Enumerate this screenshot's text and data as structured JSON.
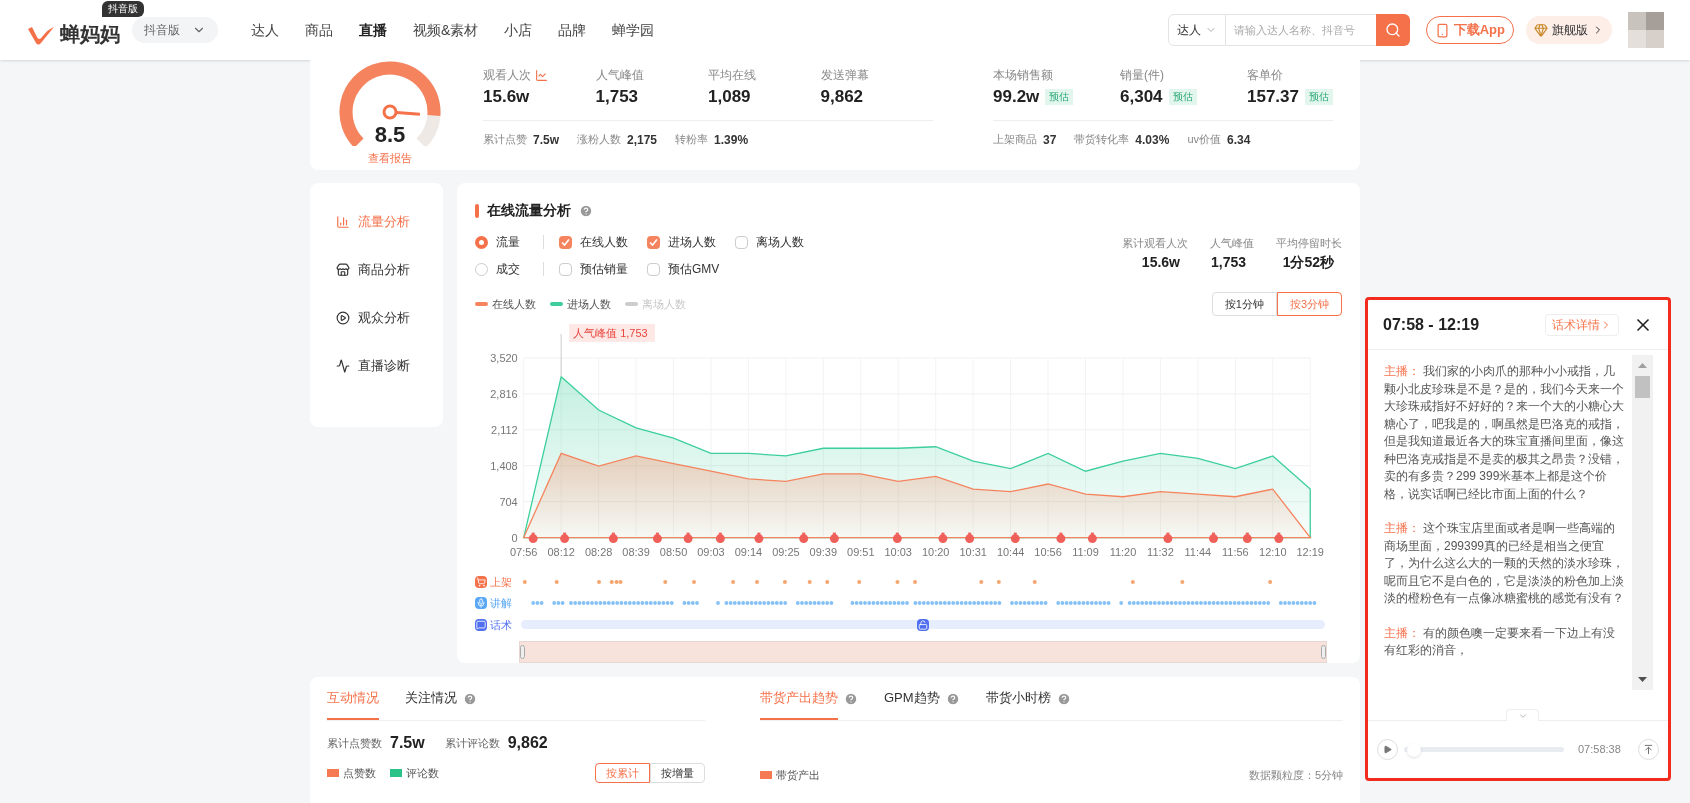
{
  "header": {
    "brand": "蝉妈妈",
    "brand_badge": "抖音版",
    "platform": "抖音版",
    "nav": [
      {
        "label": "达人",
        "selected": false
      },
      {
        "label": "商品",
        "selected": false
      },
      {
        "label": "直播",
        "selected": true
      },
      {
        "label": "视频&素材",
        "selected": false
      },
      {
        "label": "小店",
        "selected": false
      },
      {
        "label": "品牌",
        "selected": false
      },
      {
        "label": "蝉学园",
        "selected": false
      }
    ],
    "search": {
      "scope": "达人",
      "placeholder": "请输入达人名称、抖音号"
    },
    "download": "下载App",
    "plan": "旗舰版"
  },
  "summary": {
    "score": "8.5",
    "report_link": "查看报告",
    "metrics": [
      {
        "label": "观看人次",
        "value": "15.6w",
        "trend": true
      },
      {
        "label": "人气峰值",
        "value": "1,753",
        "trend": false
      },
      {
        "label": "平均在线",
        "value": "1,089",
        "trend": false
      },
      {
        "label": "发送弹幕",
        "value": "9,862",
        "trend": false
      }
    ],
    "details": [
      {
        "label": "累计点赞",
        "value": "7.5w"
      },
      {
        "label": "涨粉人数",
        "value": "2,175"
      },
      {
        "label": "转粉率",
        "value": "1.39%"
      }
    ],
    "sales": [
      {
        "label": "本场销售额",
        "value": "99.2w",
        "badge": "预估"
      },
      {
        "label": "销量(件)",
        "value": "6,304",
        "badge": "预估"
      },
      {
        "label": "客单价",
        "value": "157.37",
        "badge": "预估"
      }
    ],
    "sales_details": [
      {
        "label": "上架商品",
        "value": "37"
      },
      {
        "label": "带货转化率",
        "value": "4.03%"
      },
      {
        "label": "uv价值",
        "value": "6.34"
      }
    ]
  },
  "side_nav": [
    {
      "label": "流量分析",
      "selected": true
    },
    {
      "label": "商品分析",
      "selected": false
    },
    {
      "label": "观众分析",
      "selected": false
    },
    {
      "label": "直播诊断",
      "selected": false
    }
  ],
  "traffic": {
    "title": "在线流量分析",
    "filters": [
      {
        "mode": {
          "label": "流量",
          "selected": true
        },
        "options": [
          {
            "label": "在线人数",
            "checked": true
          },
          {
            "label": "进场人数",
            "checked": true
          },
          {
            "label": "离场人数",
            "checked": false
          }
        ]
      },
      {
        "mode": {
          "label": "成交",
          "selected": false
        },
        "options": [
          {
            "label": "预估销量",
            "checked": false
          },
          {
            "label": "预估GMV",
            "checked": false
          }
        ]
      }
    ],
    "stats": [
      {
        "label": "累计观看人次",
        "value": "15.6w"
      },
      {
        "label": "人气峰值",
        "value": "1,753"
      },
      {
        "label": "平均停留时长",
        "value": "1分52秒"
      }
    ],
    "legend_extra": [
      {
        "label": "离场人数",
        "color": "#cccccc",
        "active": false
      }
    ],
    "zoom_range": {
      "level": 1
    },
    "granularity": [
      {
        "label": "按1分钟",
        "selected": false
      },
      {
        "label": "按3分钟",
        "selected": true
      }
    ],
    "chart_data": {
      "type": "area",
      "categories": [
        "07:56",
        "08:12",
        "08:28",
        "08:39",
        "08:50",
        "09:03",
        "09:14",
        "09:25",
        "09:39",
        "09:51",
        "10:03",
        "10:20",
        "10:31",
        "10:44",
        "10:56",
        "11:09",
        "11:20",
        "11:32",
        "11:44",
        "11:56",
        "12:10",
        "12:19"
      ],
      "series": [
        {
          "name": "在线人数",
          "color": "#f5845e",
          "values": [
            0,
            1650,
            1400,
            1600,
            1450,
            1300,
            1150,
            1100,
            1250,
            1250,
            1100,
            1200,
            950,
            900,
            1050,
            850,
            800,
            900,
            850,
            800,
            950,
            0
          ]
        },
        {
          "name": "进场人数",
          "color": "#3ccf9b",
          "values": [
            0,
            3150,
            2500,
            2150,
            1950,
            1650,
            1650,
            1600,
            1750,
            1750,
            1750,
            1780,
            1500,
            1350,
            1650,
            1300,
            1500,
            1650,
            1550,
            1350,
            1600,
            950
          ]
        }
      ],
      "grid": true,
      "ylim": [
        0,
        3520
      ],
      "yticks": [
        0,
        704,
        {
          "value": 1408,
          "label": "1,408"
        },
        {
          "value": 2112,
          "label": "2,112"
        },
        {
          "value": 2816,
          "label": "2,816"
        },
        {
          "value": 3520,
          "label": "3,520"
        }
      ],
      "annotations": [
        "人气峰值 1,753"
      ]
    },
    "tracks": [
      {
        "label": "上架",
        "kind": "dots"
      },
      {
        "label": "讲解",
        "kind": "dense"
      },
      {
        "label": "话术",
        "kind": "bar"
      }
    ]
  },
  "interaction": {
    "tabs": [
      {
        "label": "互动情况",
        "selected": true,
        "help": false
      },
      {
        "label": "关注情况",
        "selected": false,
        "help": true
      }
    ],
    "totals": [
      {
        "label": "累计点赞数",
        "value": "7.5w"
      },
      {
        "label": "累计评论数",
        "value": "9,862"
      }
    ],
    "legend": [
      {
        "label": "点赞数",
        "color": "#f57a54"
      },
      {
        "label": "评论数",
        "color": "#29c287"
      }
    ],
    "modes": [
      {
        "label": "按累计",
        "selected": true
      },
      {
        "label": "按增量",
        "selected": false
      }
    ]
  },
  "sales_panel": {
    "tabs": [
      {
        "label": "带货产出趋势",
        "selected": true,
        "help": true
      },
      {
        "label": "GPM趋势",
        "selected": false,
        "help": true
      },
      {
        "label": "带货小时榜",
        "selected": false,
        "help": true
      }
    ],
    "legend": [
      {
        "label": "带货产出",
        "color": "#f57a54"
      }
    ],
    "granularity": "数据颗粒度：5分钟"
  },
  "script_panel": {
    "time_range": "07:58 - 12:19",
    "detail_button": "话术详情",
    "entries": [
      {
        "speaker": "主播：",
        "text": "我们家的小肉爪的那种小小戒指，几颗小北皮珍珠是不是？是的，我们今天来一个大珍珠戒指好不好好的？来一个大的小糖心大糖心了，吧我是的，啊虽然是巴洛克的戒指，但是我知道最近各大的珠宝直播间里面，像这种巴洛克戒指是不是卖的极其之昂贵？没错，卖的有多贵？299 399米基本上都是这个价格，说实话啊已经比市面上面的什么？"
      },
      {
        "speaker": "主播：",
        "text": "这个珠宝店里面或者是啊一些高端的商场里面，299399真的已经是相当之便宜了，为什么这么大的一颗的天然的淡水珍珠，呢而且它不是白色的，它是淡淡的粉色加上淡淡的橙粉色有一点像冰糖蜜桃的感觉有没有？"
      },
      {
        "speaker": "主播：",
        "text": "有的颜色噢一定要来看一下边上有没有红彩的消音，"
      }
    ],
    "player": {
      "level": 0.02,
      "time": "07:58:38"
    }
  }
}
